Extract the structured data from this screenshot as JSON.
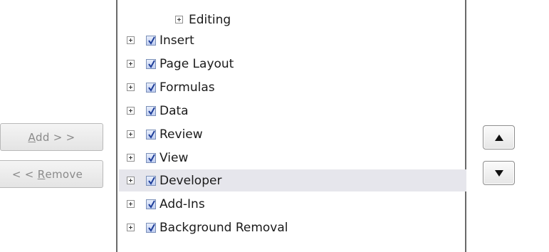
{
  "buttons": {
    "add": {
      "label_accel": "A",
      "label_rest": "dd > >"
    },
    "remove": {
      "label_prefix": "< < ",
      "label_accel": "R",
      "label_rest": "emove"
    }
  },
  "tree": {
    "partial_item": {
      "label": "Editing"
    },
    "items": [
      {
        "label": "Insert",
        "checked": true,
        "selected": false
      },
      {
        "label": "Page Layout",
        "checked": true,
        "selected": false
      },
      {
        "label": "Formulas",
        "checked": true,
        "selected": false
      },
      {
        "label": "Data",
        "checked": true,
        "selected": false
      },
      {
        "label": "Review",
        "checked": true,
        "selected": false
      },
      {
        "label": "View",
        "checked": true,
        "selected": false
      },
      {
        "label": "Developer",
        "checked": true,
        "selected": true
      },
      {
        "label": "Add-Ins",
        "checked": true,
        "selected": false
      },
      {
        "label": "Background Removal",
        "checked": true,
        "selected": false
      }
    ]
  },
  "icons": {
    "expander": "plus-box-icon",
    "checkbox": "checkmark-icon",
    "move_up": "triangle-up-icon",
    "move_down": "triangle-down-icon"
  },
  "colors": {
    "selection": "#e6e6ec",
    "checkbox_check": "#1f3f9a",
    "disabled_text": "#8a8a8a"
  }
}
